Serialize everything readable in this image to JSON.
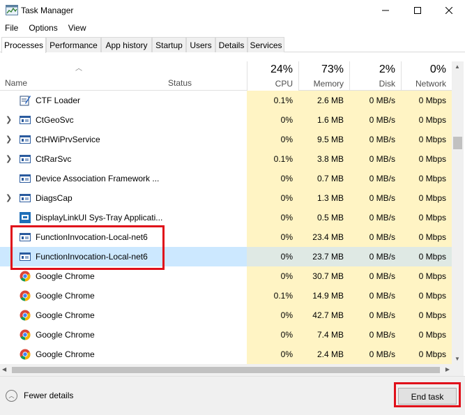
{
  "window": {
    "title": "Task Manager",
    "controls": {
      "minimize": "—",
      "maximize": "☐",
      "close": "✕"
    }
  },
  "menu": [
    "File",
    "Options",
    "View"
  ],
  "tabs": [
    {
      "label": "Processes",
      "active": true
    },
    {
      "label": "Performance",
      "active": false
    },
    {
      "label": "App history",
      "active": false
    },
    {
      "label": "Startup",
      "active": false
    },
    {
      "label": "Users",
      "active": false
    },
    {
      "label": "Details",
      "active": false
    },
    {
      "label": "Services",
      "active": false
    }
  ],
  "columns": {
    "name": "Name",
    "status": "Status",
    "cpu": {
      "percent": "24%",
      "label": "CPU"
    },
    "memory": {
      "percent": "73%",
      "label": "Memory"
    },
    "disk": {
      "percent": "2%",
      "label": "Disk"
    },
    "network": {
      "percent": "0%",
      "label": "Network"
    }
  },
  "processes": [
    {
      "name": "CTF Loader",
      "expandable": false,
      "icon": "ctf-loader-icon",
      "status": "",
      "cpu": "0.1%",
      "memory": "2.6 MB",
      "disk": "0 MB/s",
      "network": "0 Mbps",
      "selected": false
    },
    {
      "name": "CtGeoSvc",
      "expandable": true,
      "icon": "service-window-icon",
      "status": "",
      "cpu": "0%",
      "memory": "1.6 MB",
      "disk": "0 MB/s",
      "network": "0 Mbps",
      "selected": false
    },
    {
      "name": "CtHWiPrvService",
      "expandable": true,
      "icon": "service-window-icon",
      "status": "",
      "cpu": "0%",
      "memory": "9.5 MB",
      "disk": "0 MB/s",
      "network": "0 Mbps",
      "selected": false
    },
    {
      "name": "CtRarSvc",
      "expandable": true,
      "icon": "service-window-icon",
      "status": "",
      "cpu": "0.1%",
      "memory": "3.8 MB",
      "disk": "0 MB/s",
      "network": "0 Mbps",
      "selected": false
    },
    {
      "name": "Device Association Framework ...",
      "expandable": false,
      "icon": "service-window-icon",
      "status": "",
      "cpu": "0%",
      "memory": "0.7 MB",
      "disk": "0 MB/s",
      "network": "0 Mbps",
      "selected": false
    },
    {
      "name": "DiagsCap",
      "expandable": true,
      "icon": "service-window-icon",
      "status": "",
      "cpu": "0%",
      "memory": "1.3 MB",
      "disk": "0 MB/s",
      "network": "0 Mbps",
      "selected": false
    },
    {
      "name": "DisplayLinkUI Sys-Tray Applicati...",
      "expandable": false,
      "icon": "displaylink-icon",
      "status": "",
      "cpu": "0%",
      "memory": "0.5 MB",
      "disk": "0 MB/s",
      "network": "0 Mbps",
      "selected": false
    },
    {
      "name": "FunctionInvocation-Local-net6",
      "expandable": false,
      "icon": "service-window-icon",
      "status": "",
      "cpu": "0%",
      "memory": "23.4 MB",
      "disk": "0 MB/s",
      "network": "0 Mbps",
      "selected": false
    },
    {
      "name": "FunctionInvocation-Local-net6",
      "expandable": false,
      "icon": "service-window-icon",
      "status": "",
      "cpu": "0%",
      "memory": "23.7 MB",
      "disk": "0 MB/s",
      "network": "0 Mbps",
      "selected": true
    },
    {
      "name": "Google Chrome",
      "expandable": false,
      "icon": "chrome-icon",
      "status": "",
      "cpu": "0%",
      "memory": "30.7 MB",
      "disk": "0 MB/s",
      "network": "0 Mbps",
      "selected": false
    },
    {
      "name": "Google Chrome",
      "expandable": false,
      "icon": "chrome-icon",
      "status": "",
      "cpu": "0.1%",
      "memory": "14.9 MB",
      "disk": "0 MB/s",
      "network": "0 Mbps",
      "selected": false
    },
    {
      "name": "Google Chrome",
      "expandable": false,
      "icon": "chrome-icon",
      "status": "",
      "cpu": "0%",
      "memory": "42.7 MB",
      "disk": "0 MB/s",
      "network": "0 Mbps",
      "selected": false
    },
    {
      "name": "Google Chrome",
      "expandable": false,
      "icon": "chrome-icon",
      "status": "",
      "cpu": "0%",
      "memory": "7.4 MB",
      "disk": "0 MB/s",
      "network": "0 Mbps",
      "selected": false
    },
    {
      "name": "Google Chrome",
      "expandable": false,
      "icon": "chrome-icon",
      "status": "",
      "cpu": "0%",
      "memory": "2.4 MB",
      "disk": "0 MB/s",
      "network": "0 Mbps",
      "selected": false
    }
  ],
  "footer": {
    "fewer_details": "Fewer details",
    "end_task": "End task"
  },
  "colors": {
    "heat_cell": "#fff4c4",
    "selection": "#cce8ff",
    "annotation": "#e0101a"
  }
}
